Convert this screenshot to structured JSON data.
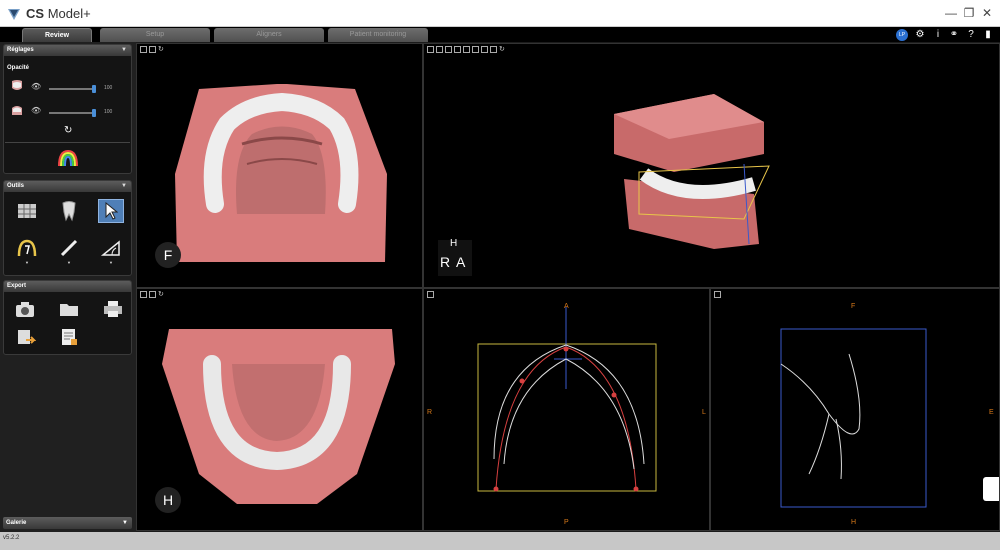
{
  "titlebar": {
    "app_name_bold": "CS",
    "app_name": "Model+"
  },
  "tabs": [
    {
      "label": "Review",
      "active": true
    },
    {
      "label": "Setup",
      "active": false
    },
    {
      "label": "Aligners",
      "active": false
    },
    {
      "label": "Patient monitoring",
      "active": false
    }
  ],
  "user_badge": "LP",
  "top_icons": [
    "user-icon",
    "settings-icon",
    "info-icon",
    "connect-icon",
    "help-icon",
    "chat-icon"
  ],
  "sidebar": {
    "reglages": {
      "title": "Réglages",
      "opacity_label": "Opacité",
      "sliders": [
        {
          "value": "100",
          "level": 1.0
        },
        {
          "value": "100",
          "level": 1.0
        }
      ]
    },
    "outils": {
      "title": "Outils"
    },
    "export": {
      "title": "Export"
    },
    "galerie": {
      "title": "Galerie"
    }
  },
  "viewports": {
    "upper_occlusal": {
      "cube_letter": "F"
    },
    "perspective": {
      "cube_letters": [
        "H",
        "R",
        "A"
      ]
    },
    "lower_occlusal": {
      "cube_letter": "H"
    },
    "arch_front": {
      "top": "A",
      "left": "R",
      "right": "L",
      "bottom": "P"
    },
    "arch_side": {
      "top": "F",
      "right": "E",
      "bottom": "H"
    }
  },
  "status": {
    "version": "v5.2.2"
  },
  "colors": {
    "gum": "#d97c7c",
    "tooth": "#e8e8e8",
    "accent_blue": "#4f7fb7",
    "orange": "#d97a1a"
  }
}
